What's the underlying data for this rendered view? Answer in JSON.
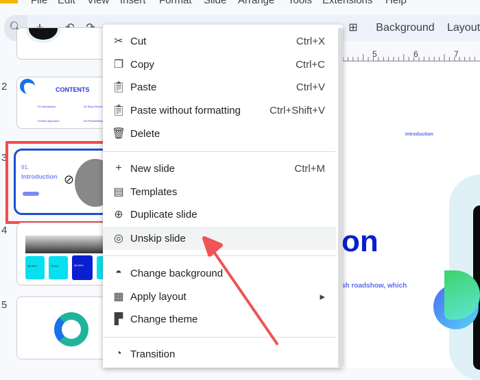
{
  "menubar": [
    "File",
    "Edit",
    "View",
    "Insert",
    "Format",
    "Slide",
    "Arrange",
    "Tools",
    "Extensions",
    "Help"
  ],
  "toolbar": {
    "background_label": "Background",
    "layout_label": "Layout"
  },
  "ruler": [
    "5",
    "6",
    "7"
  ],
  "slides": [
    {
      "number": "2",
      "title": "CONTENTS",
      "items": [
        "01.Introduction",
        "02.Step Structure",
        "03.New Approach",
        "04.Presentation"
      ]
    },
    {
      "number": "3",
      "title": "01.",
      "subtitle": "Introduction",
      "skipped": true
    },
    {
      "number": "4",
      "stats": [
        "36.33%",
        "72.9%",
        "56.99%"
      ]
    },
    {
      "number": "5"
    }
  ],
  "canvas": {
    "label": "Introduction",
    "title_fragment": "on",
    "body_fragment": "sh roadshow, which"
  },
  "context_menu": [
    {
      "icon": "scissors-icon",
      "label": "Cut",
      "shortcut": "Ctrl+X"
    },
    {
      "icon": "copy-icon",
      "label": "Copy",
      "shortcut": "Ctrl+C"
    },
    {
      "icon": "clipboard-icon",
      "label": "Paste",
      "shortcut": "Ctrl+V"
    },
    {
      "icon": "paste-plain-icon",
      "label": "Paste without formatting",
      "shortcut": "Ctrl+Shift+V"
    },
    {
      "icon": "trash-icon",
      "label": "Delete",
      "shortcut": ""
    },
    {
      "icon": "plus-icon",
      "label": "New slide",
      "shortcut": "Ctrl+M"
    },
    {
      "icon": "templates-icon",
      "label": "Templates",
      "shortcut": ""
    },
    {
      "icon": "duplicate-icon",
      "label": "Duplicate slide",
      "shortcut": ""
    },
    {
      "icon": "eye-off-icon",
      "label": "Unskip slide",
      "shortcut": ""
    },
    {
      "icon": "fill-drop-icon",
      "label": "Change background",
      "shortcut": ""
    },
    {
      "icon": "layout-icon",
      "label": "Apply layout",
      "shortcut": "▸"
    },
    {
      "icon": "paint-roller-icon",
      "label": "Change theme",
      "shortcut": ""
    },
    {
      "icon": "transition-icon",
      "label": "Transition",
      "shortcut": ""
    }
  ],
  "colors": {
    "accent": "#0a1fd1",
    "highlight": "#f44b4b",
    "arrow": "#f05454"
  }
}
